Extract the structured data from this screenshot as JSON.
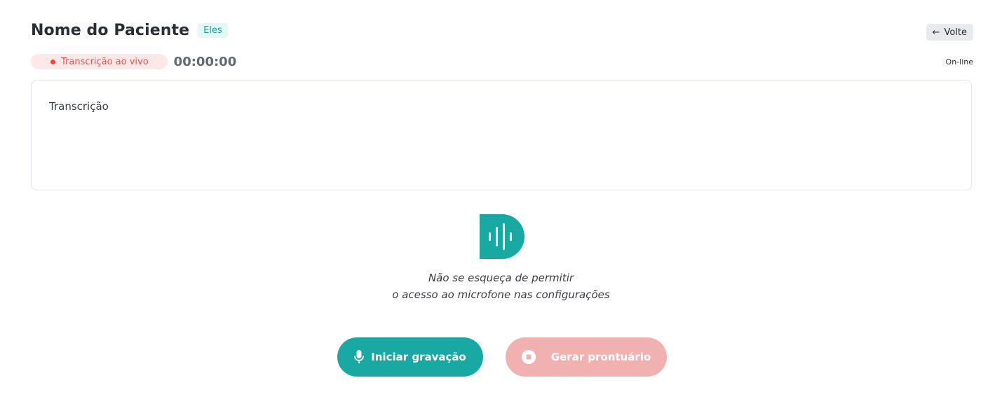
{
  "header": {
    "patient_name": "Nome do Paciente",
    "gender_badge": "Eles",
    "back_button": {
      "arrow": "←",
      "label": "Volte"
    }
  },
  "status": {
    "live_label": "Transcrição ao vivo",
    "timer": "00:00:00",
    "connection": "On-line"
  },
  "transcript": {
    "label": "Transcrição"
  },
  "hint": {
    "line1": "Não se esqueça de permitir",
    "line2": "o acesso ao microfone nas configurações"
  },
  "actions": {
    "start_recording": {
      "label": "Iniciar gravação",
      "icon": "microphone-icon"
    },
    "generate_record": {
      "label": "Gerar prontuário",
      "icon": "stop-icon"
    }
  },
  "colors": {
    "accent": "#17a9a2",
    "live_red": "#f04438",
    "disabled_button": "#f2b1b1",
    "badge_bg": "#e3f7f6"
  }
}
